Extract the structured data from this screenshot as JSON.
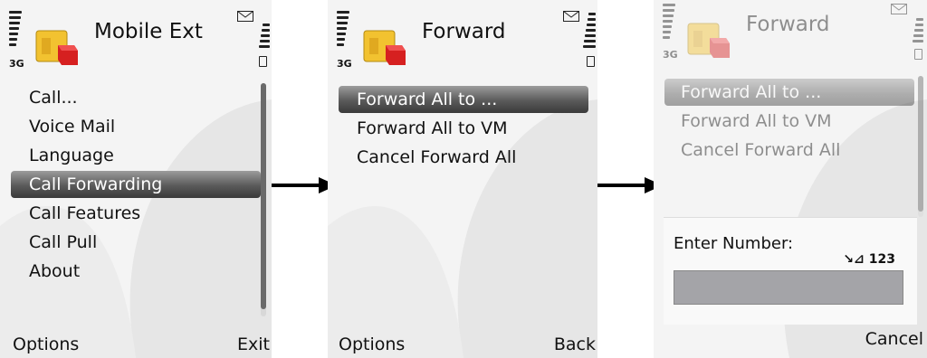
{
  "network": "3G",
  "screens": [
    {
      "title": "Mobile Ext",
      "menu": [
        "Call...",
        "Voice Mail",
        "Language",
        "Call Forwarding",
        "Call Features",
        "Call Pull",
        "About"
      ],
      "selected_index": 3,
      "softkeys": {
        "left": "Options",
        "right": "Exit"
      }
    },
    {
      "title": "Forward",
      "menu": [
        "Forward All to ...",
        "Forward All to VM",
        "Cancel Forward All"
      ],
      "selected_index": 0,
      "softkeys": {
        "left": "Options",
        "right": "Back"
      }
    },
    {
      "title": "Forward",
      "menu": [
        "Forward All to ...",
        "Forward All to VM",
        "Cancel Forward All"
      ],
      "selected_index": 0,
      "dialog": {
        "prompt": "Enter Number:",
        "input_mode": "123",
        "value": ""
      },
      "softkeys": {
        "right": "Cancel"
      }
    }
  ]
}
